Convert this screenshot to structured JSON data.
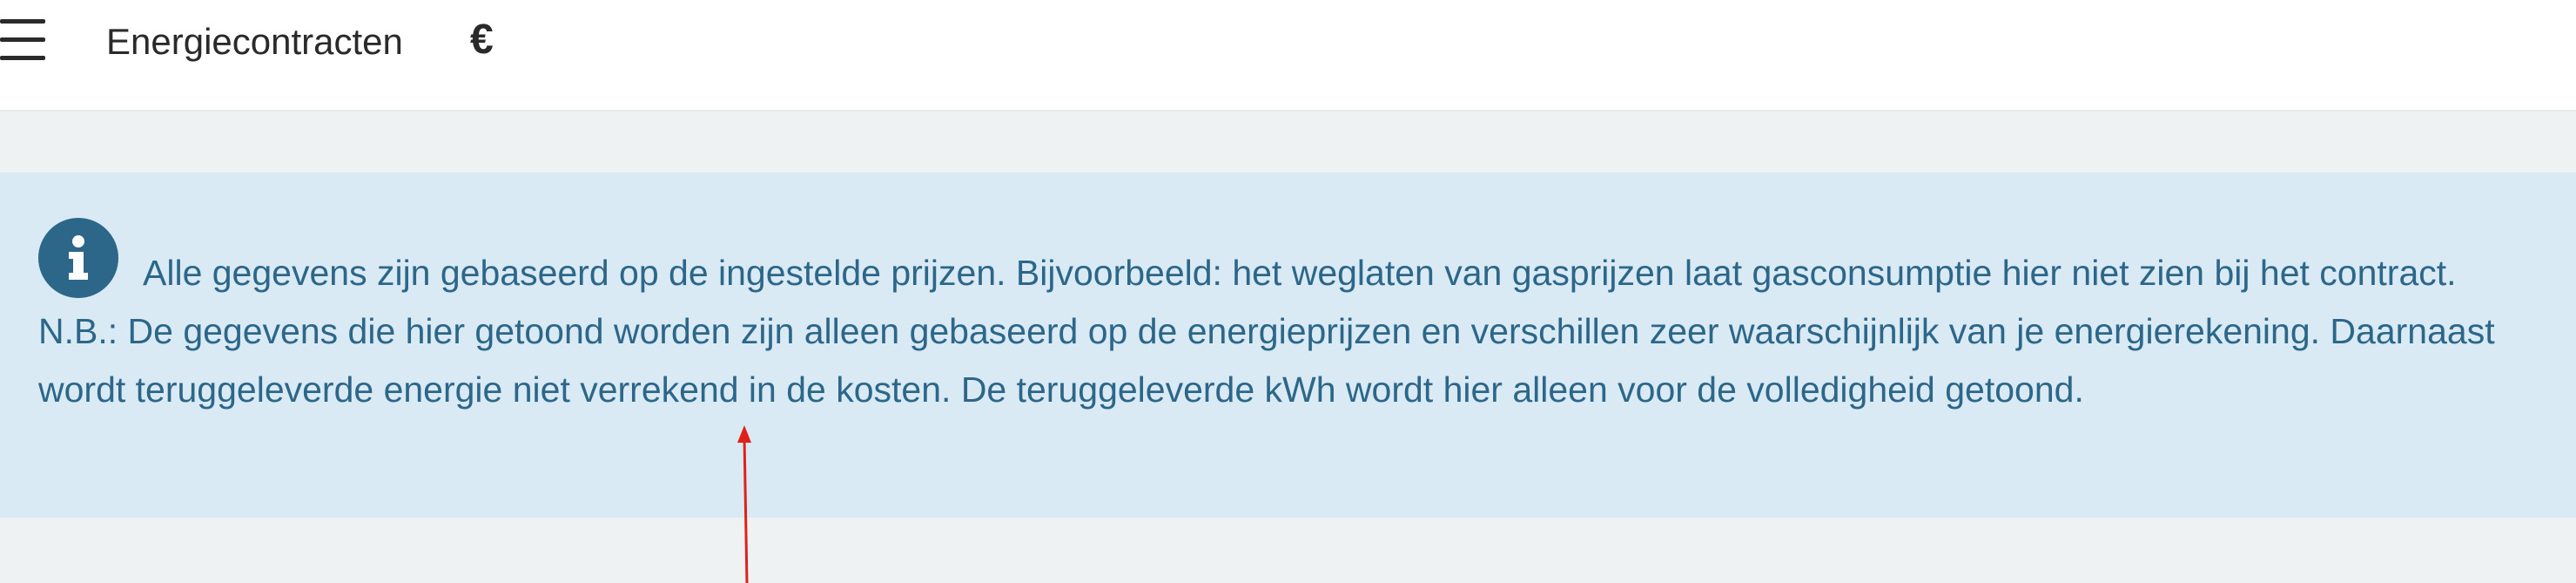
{
  "header": {
    "title": "Energiecontracten",
    "currency_symbol": "€",
    "menu_icon": "hamburger-menu-icon"
  },
  "info_banner": {
    "icon": "info-icon",
    "text": "Alle gegevens zijn gebaseerd op de ingestelde prijzen. Bijvoorbeeld: het weglaten van gasprijzen laat gasconsumptie hier niet zien bij het contract. N.B.: De gegevens die hier getoond worden zijn alleen gebaseerd op de energieprijzen en verschillen zeer waarschijnlijk van je energierekening. Daarnaast wordt teruggeleverde energie niet verrekend in de kosten. De teruggeleverde kWh wordt hier alleen voor de volledigheid getoond."
  },
  "colors": {
    "banner_background": "#d9eaf5",
    "banner_text": "#2c6689",
    "page_background": "#eef2f3",
    "annotation_arrow": "#e0201a"
  }
}
